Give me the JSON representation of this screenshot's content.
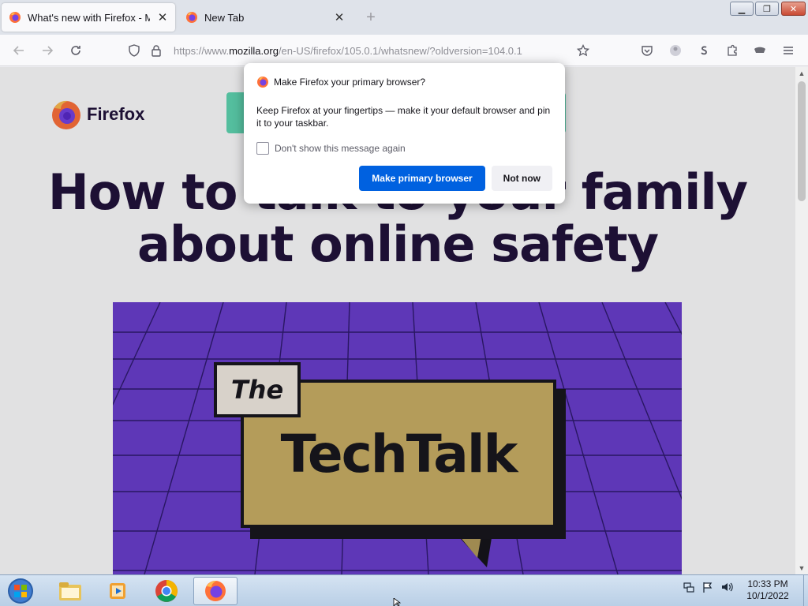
{
  "browser": {
    "tabs": [
      {
        "title": "What's new with Firefox - More",
        "active": true
      },
      {
        "title": "New Tab",
        "active": false
      }
    ],
    "url": {
      "prefix": "https://www.",
      "host": "mozilla.org",
      "path": "/en-US/firefox/105.0.1/whatsnew/?oldversion=104.0.1"
    }
  },
  "page": {
    "brand": "Firefox",
    "headline_line1": "How to talk to your family",
    "headline_line2": "about online safety",
    "hero": {
      "the_label": "The",
      "techtalk_label": "TechTalk"
    }
  },
  "dialog": {
    "title": "Make Firefox your primary browser?",
    "body": "Keep Firefox at your fingertips — make it your default browser and pin it to your taskbar.",
    "checkbox_label": "Don't show this message again",
    "checkbox_checked": false,
    "primary_button": "Make primary browser",
    "secondary_button": "Not now"
  },
  "taskbar": {
    "apps": [
      "windows-explorer",
      "media-player",
      "chrome",
      "firefox"
    ],
    "active_app": "firefox",
    "time": "10:33 PM",
    "date": "10/1/2022"
  },
  "colors": {
    "primary_button": "#0061e0",
    "hero_purple": "#6a3ecf",
    "talk_box": "#b49c5a",
    "headline": "#20123a"
  }
}
